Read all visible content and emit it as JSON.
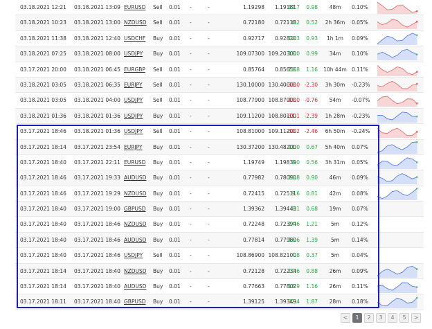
{
  "trades": [
    {
      "open_date": "03.18.2021 12:21",
      "close_date": "03.18.2021 13:09",
      "symbol": "EURUSD",
      "action": "Sell",
      "lots": "0.01",
      "sl": "-",
      "tp": "-",
      "open_price": "1.19298",
      "close_price": "1.19181",
      "pips": "11.7",
      "profit": "0.98",
      "duration": "48m",
      "gain": "0.10%",
      "spark": "red"
    },
    {
      "open_date": "03.18.2021 10:23",
      "close_date": "03.18.2021 13:00",
      "symbol": "NZDUSD",
      "action": "Sell",
      "lots": "0.01",
      "sl": "-",
      "tp": "-",
      "open_price": "0.72180",
      "close_price": "0.72118",
      "pips": "6.2",
      "profit": "0.52",
      "duration": "2h 36m",
      "gain": "0.05%",
      "spark": "red"
    },
    {
      "open_date": "03.18.2021 11:38",
      "close_date": "03.18.2021 12:40",
      "symbol": "USDCHF",
      "action": "Buy",
      "lots": "0.01",
      "sl": "-",
      "tp": "-",
      "open_price": "0.92717",
      "close_price": "0.92820",
      "pips": "10.3",
      "profit": "0.93",
      "duration": "1h 1m",
      "gain": "0.09%",
      "spark": "blue"
    },
    {
      "open_date": "03.18.2021 07:25",
      "close_date": "03.18.2021 08:00",
      "symbol": "USDJPY",
      "action": "Buy",
      "lots": "0.01",
      "sl": "-",
      "tp": "-",
      "open_price": "109.07300",
      "close_price": "109.20300",
      "pips": "13.0",
      "profit": "0.99",
      "duration": "34m",
      "gain": "0.10%",
      "spark": "blue"
    },
    {
      "open_date": "03.17.2021 20:00",
      "close_date": "03.18.2021 06:45",
      "symbol": "EURGBP",
      "action": "Sell",
      "lots": "0.01",
      "sl": "-",
      "tp": "-",
      "open_price": "0.85764",
      "close_price": "0.85656",
      "pips": "10.8",
      "profit": "1.16",
      "duration": "10h 44m",
      "gain": "0.11%",
      "spark": "red"
    },
    {
      "open_date": "03.18.2021 03:05",
      "close_date": "03.18.2021 06:35",
      "symbol": "EURJPY",
      "action": "Sell",
      "lots": "0.01",
      "sl": "-",
      "tp": "-",
      "open_price": "130.10000",
      "close_price": "130.40000",
      "pips": "-30.0",
      "profit": "-2.30",
      "duration": "3h 30m",
      "gain": "-0.23%",
      "spark": "red"
    },
    {
      "open_date": "03.18.2021 03:05",
      "close_date": "03.18.2021 04:00",
      "symbol": "USDJPY",
      "action": "Sell",
      "lots": "0.01",
      "sl": "-",
      "tp": "-",
      "open_price": "108.77900",
      "close_price": "108.87900",
      "pips": "-10.0",
      "profit": "-0.76",
      "duration": "54m",
      "gain": "-0.07%",
      "spark": "red"
    },
    {
      "open_date": "03.18.2021 01:36",
      "close_date": "03.18.2021 01:36",
      "symbol": "USDJPY",
      "action": "Buy",
      "lots": "0.01",
      "sl": "-",
      "tp": "-",
      "open_price": "109.11200",
      "close_price": "108.80100",
      "pips": "-31.1",
      "profit": "-2.39",
      "duration": "1h 28m",
      "gain": "-0.23%",
      "spark": "blue"
    },
    {
      "open_date": "03.17.2021 18:46",
      "close_date": "03.18.2021 01:36",
      "symbol": "USDJPY",
      "action": "Sell",
      "lots": "0.01",
      "sl": "-",
      "tp": "-",
      "open_price": "108.81000",
      "close_price": "109.11200",
      "pips": "-30.2",
      "profit": "-2.46",
      "duration": "6h 50m",
      "gain": "-0.24%",
      "spark": "red"
    },
    {
      "open_date": "03.17.2021 18:14",
      "close_date": "03.17.2021 23:54",
      "symbol": "EURJPY",
      "action": "Buy",
      "lots": "0.01",
      "sl": "-",
      "tp": "-",
      "open_price": "130.37200",
      "close_price": "130.48200",
      "pips": "11.0",
      "profit": "0.67",
      "duration": "5h 40m",
      "gain": "0.07%",
      "spark": "blue"
    },
    {
      "open_date": "03.17.2021 18:40",
      "close_date": "03.17.2021 22:11",
      "symbol": "EURUSD",
      "action": "Buy",
      "lots": "0.01",
      "sl": "-",
      "tp": "-",
      "open_price": "1.19749",
      "close_price": "1.19839",
      "pips": "9.0",
      "profit": "0.56",
      "duration": "3h 31m",
      "gain": "0.05%",
      "spark": "blue"
    },
    {
      "open_date": "03.17.2021 18:46",
      "close_date": "03.17.2021 19:33",
      "symbol": "AUDUSD",
      "action": "Buy",
      "lots": "0.01",
      "sl": "-",
      "tp": "-",
      "open_price": "0.77982",
      "close_price": "0.78090",
      "pips": "10.8",
      "profit": "0.90",
      "duration": "46m",
      "gain": "0.09%",
      "spark": "blue"
    },
    {
      "open_date": "03.17.2021 18:46",
      "close_date": "03.17.2021 19:29",
      "symbol": "NZDUSD",
      "action": "Buy",
      "lots": "0.01",
      "sl": "-",
      "tp": "-",
      "open_price": "0.72415",
      "close_price": "0.72511",
      "pips": "9.6",
      "profit": "0.81",
      "duration": "42m",
      "gain": "0.08%",
      "spark": "blue"
    },
    {
      "open_date": "03.17.2021 18:40",
      "close_date": "03.17.2021 19:00",
      "symbol": "GBPUSD",
      "action": "Buy",
      "lots": "0.01",
      "sl": "-",
      "tp": "-",
      "open_price": "1.39362",
      "close_price": "1.39443",
      "pips": "8.1",
      "profit": "0.68",
      "duration": "19m",
      "gain": "0.07%",
      "spark": ""
    },
    {
      "open_date": "03.17.2021 18:40",
      "close_date": "03.17.2021 18:46",
      "symbol": "NZDUSD",
      "action": "Buy",
      "lots": "0.01",
      "sl": "-",
      "tp": "-",
      "open_price": "0.72248",
      "close_price": "0.72394",
      "pips": "14.6",
      "profit": "1.21",
      "duration": "5m",
      "gain": "0.12%",
      "spark": ""
    },
    {
      "open_date": "03.17.2021 18:40",
      "close_date": "03.17.2021 18:46",
      "symbol": "AUDUSD",
      "action": "Buy",
      "lots": "0.01",
      "sl": "-",
      "tp": "-",
      "open_price": "0.77814",
      "close_price": "0.77980",
      "pips": "16.6",
      "profit": "1.39",
      "duration": "5m",
      "gain": "0.14%",
      "spark": ""
    },
    {
      "open_date": "03.17.2021 18:40",
      "close_date": "03.17.2021 18:46",
      "symbol": "USDJPY",
      "action": "Sell",
      "lots": "0.01",
      "sl": "-",
      "tp": "-",
      "open_price": "108.86900",
      "close_price": "108.82100",
      "pips": "4.8",
      "profit": "0.37",
      "duration": "5m",
      "gain": "0.04%",
      "spark": ""
    },
    {
      "open_date": "03.17.2021 18:14",
      "close_date": "03.17.2021 18:40",
      "symbol": "NZDUSD",
      "action": "Buy",
      "lots": "0.01",
      "sl": "-",
      "tp": "-",
      "open_price": "0.72128",
      "close_price": "0.72234",
      "pips": "10.6",
      "profit": "0.88",
      "duration": "26m",
      "gain": "0.09%",
      "spark": "blue"
    },
    {
      "open_date": "03.17.2021 18:14",
      "close_date": "03.17.2021 18:40",
      "symbol": "AUDUSD",
      "action": "Buy",
      "lots": "0.01",
      "sl": "-",
      "tp": "-",
      "open_price": "0.77663",
      "close_price": "0.77802",
      "pips": "13.9",
      "profit": "1.16",
      "duration": "26m",
      "gain": "0.11%",
      "spark": "blue"
    },
    {
      "open_date": "03.17.2021 18:11",
      "close_date": "03.17.2021 18:40",
      "symbol": "GBPUSD",
      "action": "Buy",
      "lots": "0.01",
      "sl": "-",
      "tp": "-",
      "open_price": "1.39125",
      "close_price": "1.39349",
      "pips": "22.4",
      "profit": "1.87",
      "duration": "28m",
      "gain": "0.18%",
      "spark": "blue"
    }
  ],
  "pagination": {
    "prev": "<",
    "pages": [
      "1",
      "2",
      "3",
      "4",
      "5"
    ],
    "next": ">",
    "current": "1"
  },
  "colors": {
    "positive": "#27a841",
    "negative": "#e0262b",
    "highlight": "#1b1fb5",
    "spark_red_line": "#e07070",
    "spark_red_fill": "#f6d6d6",
    "spark_blue_line": "#5a7fd6",
    "spark_blue_fill": "#d5e0f8"
  }
}
